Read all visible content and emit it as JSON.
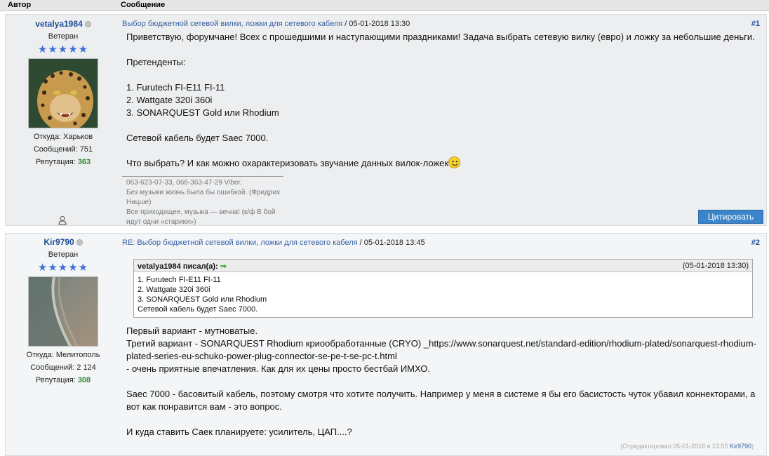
{
  "table_header": {
    "author": "Автор",
    "message": "Сообщение"
  },
  "posts": [
    {
      "username": "vetalya1984",
      "rank": "Ветеран",
      "stars": "★★★★★",
      "location_label": "Откуда: Харьков",
      "messages_label": "Сообщений: 751",
      "reputation_label": "Репутация:",
      "reputation_value": "363",
      "title": "Выбор бюджетной сетевой вилки, ложки для сетевого кабеля",
      "date": " / 05-01-2018 13:30",
      "number": "#1",
      "body": [
        "Приветствую, форумчане! Всех с прошедшими и наступающими праздниками! Задача выбрать сетевую вилку (евро) и ложку за небольшие деньги.",
        "Претенденты:",
        "1. Furutech FI-E11 FI-11",
        "2. Wattgate 320i 360i",
        "3. SONARQUEST Gold или Rhodium",
        "Сетевой кабель будет Saec 7000.",
        "Что выбрать? И как можно охарактеризовать звучание данных вилок-ложек"
      ],
      "signature": [
        "063-623-07-33, 066-363-47-29 Viber.",
        "Без музыки жизнь была бы ошибкой. (Фридрих Ницше)",
        "Все приходящее, музыка — вечна! (к/ф В бой идут одни «старики»)"
      ],
      "quote_button": "Цитировать"
    },
    {
      "username": "Kir9790",
      "rank": "Ветеран",
      "stars": "★★★★★",
      "location_label": "Откуда: Мелитополь",
      "messages_label": "Сообщений: 2 124",
      "reputation_label": "Репутация:",
      "reputation_value": "308",
      "title": "RE: Выбор бюджетной сетевой вилки, ложки для сетевого кабеля",
      "date": " / 05-01-2018 13:45",
      "number": "#2",
      "quote": {
        "author": "vetalya1984 писал(а):",
        "date": "(05-01-2018 13:30)",
        "lines": [
          "1. Furutech FI-E11 FI-11",
          "2. Wattgate 320i 360i",
          "3. SONARQUEST Gold или Rhodium",
          "Сетевой кабель будет Saec 7000."
        ]
      },
      "body": [
        "Первый вариант - мутноватые.",
        "Третий вариант - SONARQUEST Rhodium криообработанные (CRYO) _https://www.sonarquest.net/standard-edition/rhodium-plated/sonarquest-rhodium-plated-series-eu-schuko-power-plug-connector-se-pe-t-se-pc-t.html",
        "- очень приятные впечатления. Как для их цены просто бестбай ИМХО.",
        "Saec 7000 - басовитый кабель, поэтому смотря что хотите получить. Например у меня в системе я бы его басистость чуток убавил коннекторами, а вот как понравится вам - это вопрос.",
        "И куда ставить Саек планируете: усилитель, ЦАП....?"
      ],
      "edited_prefix": "(Отредактировал 05-01-2018 в 13:55 ",
      "edited_user": "Kir9790",
      "edited_suffix": ")"
    }
  ]
}
